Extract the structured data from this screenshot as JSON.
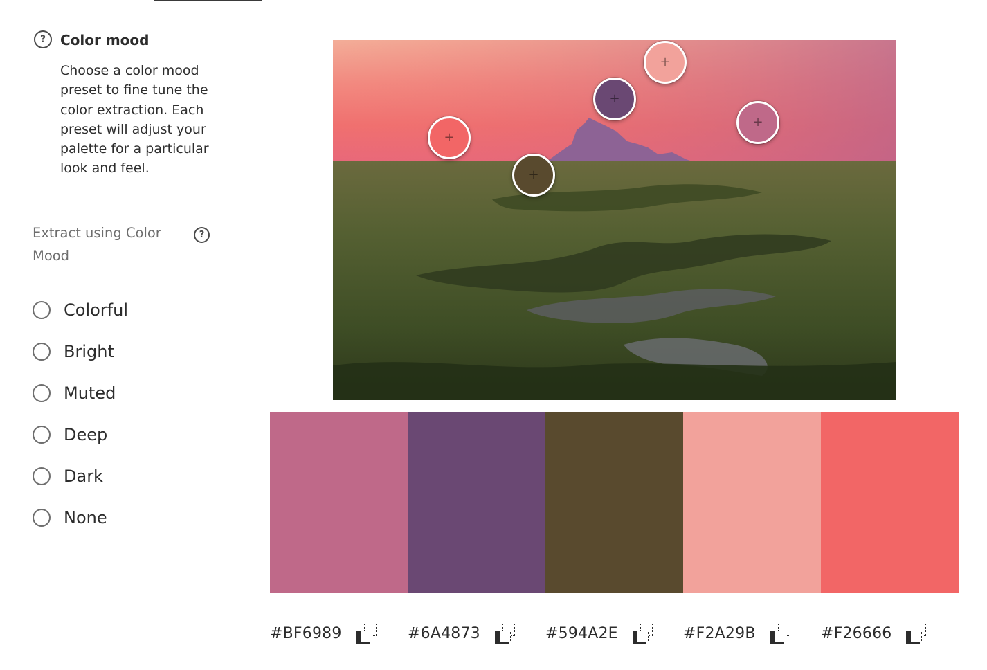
{
  "color_mood": {
    "title": "Color mood",
    "description": "Choose a color mood preset to fine tune the color extraction. Each preset will adjust your palette for a particular look and feel.",
    "help_icon": "question-circle-icon"
  },
  "extract": {
    "label": "Extract using Color Mood",
    "help_icon": "question-circle-icon",
    "options": [
      {
        "label": "Colorful",
        "selected": false
      },
      {
        "label": "Bright",
        "selected": false
      },
      {
        "label": "Muted",
        "selected": false
      },
      {
        "label": "Deep",
        "selected": false
      },
      {
        "label": "Dark",
        "selected": false
      },
      {
        "label": "None",
        "selected": false
      }
    ]
  },
  "palette": {
    "swatches": [
      {
        "hex": "#BF6989",
        "color": "#BF6989"
      },
      {
        "hex": "#6A4873",
        "color": "#6A4873"
      },
      {
        "hex": "#594A2E",
        "color": "#594A2E"
      },
      {
        "hex": "#F2A29B",
        "color": "#F2A29B"
      },
      {
        "hex": "#F26666",
        "color": "#F26666"
      }
    ],
    "copy_icon": "copy-icon"
  },
  "pickers": [
    {
      "color": "#F2A29B"
    },
    {
      "color": "#6A4873"
    },
    {
      "color": "#BF6989"
    },
    {
      "color": "#F26666"
    },
    {
      "color": "#594A2E"
    }
  ]
}
